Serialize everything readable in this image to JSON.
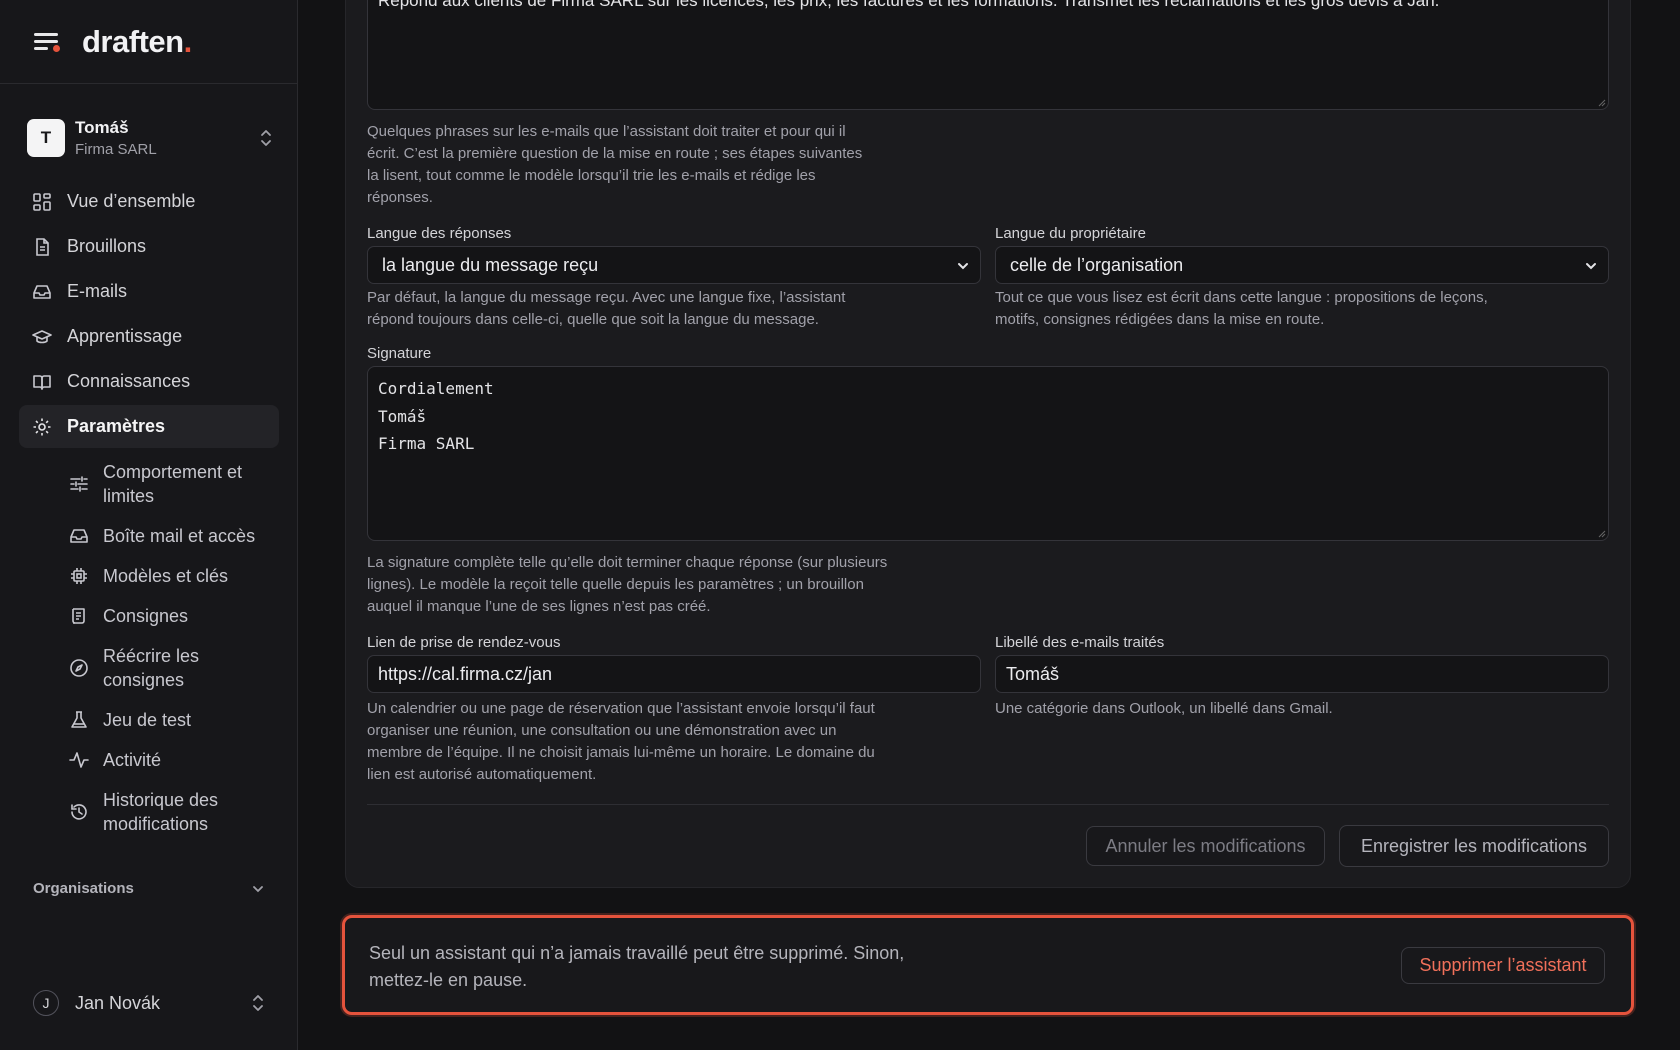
{
  "brand": {
    "logo_text": "draften",
    "logo_dot": "."
  },
  "account": {
    "initial": "T",
    "name": "Tomáš",
    "org": "Firma SARL"
  },
  "nav": [
    {
      "label": "Vue d’ensemble",
      "icon": "dashboard-icon"
    },
    {
      "label": "Brouillons",
      "icon": "document-icon"
    },
    {
      "label": "E-mails",
      "icon": "inbox-icon"
    },
    {
      "label": "Apprentissage",
      "icon": "graduation-cap-icon"
    },
    {
      "label": "Connaissances",
      "icon": "book-icon"
    },
    {
      "label": "Paramètres",
      "icon": "gear-icon",
      "active": true
    }
  ],
  "subnav": [
    {
      "label": "Comportement et limites",
      "icon": "sliders-icon"
    },
    {
      "label": "Boîte mail et accès",
      "icon": "inbox-icon"
    },
    {
      "label": "Modèles et clés",
      "icon": "chip-icon"
    },
    {
      "label": "Consignes",
      "icon": "scroll-icon"
    },
    {
      "label": "Réécrire les consignes",
      "icon": "compass-icon"
    },
    {
      "label": "Jeu de test",
      "icon": "flask-icon"
    },
    {
      "label": "Activité",
      "icon": "activity-icon"
    },
    {
      "label": "Historique des modifications",
      "icon": "history-icon"
    }
  ],
  "organisations_label": "Organisations",
  "user": {
    "initial": "J",
    "name": "Jan Novák"
  },
  "form": {
    "description_value": "Répond aux clients de Firma SARL sur les licences, les prix, les factures et les formations. Transmet les réclamations et les gros devis à Jan.",
    "description_help": "Quelques phrases sur les e-mails que l’assistant doit traiter et pour qui il écrit. C’est la première question de la mise en route ; ses étapes suivantes la lisent, tout comme le modèle lorsqu’il trie les e-mails et rédige les réponses.",
    "reply_language_label": "Langue des réponses",
    "reply_language_value": "la langue du message reçu",
    "reply_language_help": "Par défaut, la langue du message reçu. Avec une langue fixe, l’assistant répond toujours dans celle-ci, quelle que soit la langue du message.",
    "owner_language_label": "Langue du propriétaire",
    "owner_language_value": "celle de l’organisation",
    "owner_language_help": "Tout ce que vous lisez est écrit dans cette langue : propositions de leçons, motifs, consignes rédigées dans la mise en route.",
    "signature_label": "Signature",
    "signature_value": "Cordialement\nTomáš\nFirma SARL",
    "signature_help": "La signature complète telle qu’elle doit terminer chaque réponse (sur plusieurs lignes). Le modèle la reçoit telle quelle depuis les paramètres ; un brouillon auquel il manque l’une de ses lignes n’est pas créé.",
    "booking_label": "Lien de prise de rendez-vous",
    "booking_value": "https://cal.firma.cz/jan",
    "booking_help": "Un calendrier ou une page de réservation que l’assistant envoie lorsqu’il faut organiser une réunion, une consultation ou une démonstration avec un membre de l’équipe. Il ne choisit jamais lui-même un horaire. Le domaine du lien est autorisé automatiquement.",
    "tag_label": "Libellé des e-mails traités",
    "tag_value": "Tomáš",
    "tag_help": "Une catégorie dans Outlook, un libellé dans Gmail.",
    "cancel_label": "Annuler les modifications",
    "save_label": "Enregistrer les modifications"
  },
  "danger": {
    "text": "Seul un assistant qui n’a jamais travaillé peut être supprimé. Sinon, mettez-le en pause.",
    "button_label": "Supprimer l’assistant"
  },
  "colors": {
    "accent": "#e5533c",
    "background": "#121214",
    "sidebar": "#17171a"
  }
}
